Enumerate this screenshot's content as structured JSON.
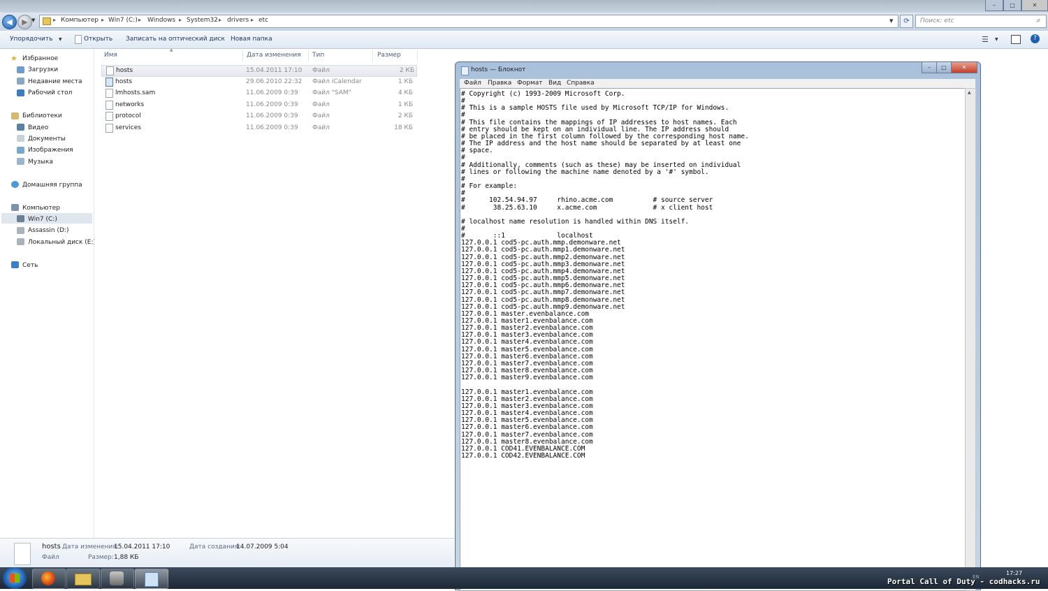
{
  "explorer": {
    "breadcrumb": [
      "Компьютер",
      "Win7 (C:)",
      "Windows",
      "System32",
      "drivers",
      "etc"
    ],
    "search_placeholder": "Поиск: etc",
    "toolbar": {
      "organize": "Упорядочить",
      "open": "Открыть",
      "burn": "Записать на оптический диск",
      "new_folder": "Новая папка"
    },
    "nav": {
      "favorites": "Избранное",
      "downloads": "Загрузки",
      "recent": "Недавние места",
      "desktop": "Рабочий стол",
      "libraries": "Библиотеки",
      "video": "Видео",
      "documents": "Документы",
      "images": "Изображения",
      "music": "Музыка",
      "homegroup": "Домашняя группа",
      "computer": "Компьютер",
      "drive_c": "Win7 (C:)",
      "drive_d": "Assassin (D:)",
      "drive_e": "Локальный диск (E:)",
      "network": "Сеть"
    },
    "columns": {
      "name": "Имя",
      "date": "Дата изменения",
      "type": "Тип",
      "size": "Размер"
    },
    "files": [
      {
        "name": "hosts",
        "date": "15.04.2011 17:10",
        "type": "Файл",
        "size": "2 КБ"
      },
      {
        "name": "hosts",
        "date": "29.06.2010 22:32",
        "type": "Файл iCalendar",
        "size": "1 КБ"
      },
      {
        "name": "lmhosts.sam",
        "date": "11.06.2009 0:39",
        "type": "Файл \"SAM\"",
        "size": "4 КБ"
      },
      {
        "name": "networks",
        "date": "11.06.2009 0:39",
        "type": "Файл",
        "size": "1 КБ"
      },
      {
        "name": "protocol",
        "date": "11.06.2009 0:39",
        "type": "Файл",
        "size": "2 КБ"
      },
      {
        "name": "services",
        "date": "11.06.2009 0:39",
        "type": "Файл",
        "size": "18 КБ"
      }
    ],
    "details": {
      "filename": "hosts",
      "type": "Файл",
      "modified_label": "Дата изменения:",
      "modified": "15.04.2011 17:10",
      "created_label": "Дата создания:",
      "created": "14.07.2009 5:04",
      "size_label": "Размер:",
      "size": "1,88 КБ"
    }
  },
  "notepad": {
    "title": "hosts — Блокнот",
    "menu": {
      "file": "Файл",
      "edit": "Правка",
      "format": "Формат",
      "view": "Вид",
      "help": "Справка"
    },
    "content": "# Copyright (c) 1993-2009 Microsoft Corp.\n#\n# This is a sample HOSTS file used by Microsoft TCP/IP for Windows.\n#\n# This file contains the mappings of IP addresses to host names. Each\n# entry should be kept on an individual line. The IP address should\n# be placed in the first column followed by the corresponding host name.\n# The IP address and the host name should be separated by at least one\n# space.\n#\n# Additionally, comments (such as these) may be inserted on individual\n# lines or following the machine name denoted by a '#' symbol.\n#\n# For example:\n#\n#      102.54.94.97     rhino.acme.com          # source server\n#       38.25.63.10     x.acme.com              # x client host\n\n# localhost name resolution is handled within DNS itself.\n#\n#       ::1             localhost\n127.0.0.1 cod5-pc.auth.mmp.demonware.net\n127.0.0.1 cod5-pc.auth.mmp1.demonware.net\n127.0.0.1 cod5-pc.auth.mmp2.demonware.net\n127.0.0.1 cod5-pc.auth.mmp3.demonware.net\n127.0.0.1 cod5-pc.auth.mmp4.demonware.net\n127.0.0.1 cod5-pc.auth.mmp5.demonware.net\n127.0.0.1 cod5-pc.auth.mmp6.demonware.net\n127.0.0.1 cod5-pc.auth.mmp7.demonware.net\n127.0.0.1 cod5-pc.auth.mmp8.demonware.net\n127.0.0.1 cod5-pc.auth.mmp9.demonware.net\n127.0.0.1 master.evenbalance.com\n127.0.0.1 master1.evenbalance.com\n127.0.0.1 master2.evenbalance.com\n127.0.0.1 master3.evenbalance.com\n127.0.0.1 master4.evenbalance.com\n127.0.0.1 master5.evenbalance.com\n127.0.0.1 master6.evenbalance.com\n127.0.0.1 master7.evenbalance.com\n127.0.0.1 master8.evenbalance.com\n127.0.0.1 master9.evenbalance.com\n\n127.0.0.1 master1.evenbalance.com\n127.0.0.1 master2.evenbalance.com\n127.0.0.1 master3.evenbalance.com\n127.0.0.1 master4.evenbalance.com\n127.0.0.1 master5.evenbalance.com\n127.0.0.1 master6.evenbalance.com\n127.0.0.1 master7.evenbalance.com\n127.0.0.1 master8.evenbalance.com\n127.0.0.1 COD41.EVENBALANCE.COM\n127.0.0.1 COD42.EVENBALANCE.COM"
  },
  "taskbar": {
    "clock": "17:27",
    "lang": "EN",
    "apps": [
      "firefox-icon",
      "explorer-icon",
      "cod-icon",
      "notepad-icon"
    ]
  },
  "watermark": "Portal Call of Duty - codhacks.ru",
  "colors": {
    "accent": "#1f5fb1",
    "taskbar": "#1d2836",
    "selection": "#e4e8ee"
  }
}
